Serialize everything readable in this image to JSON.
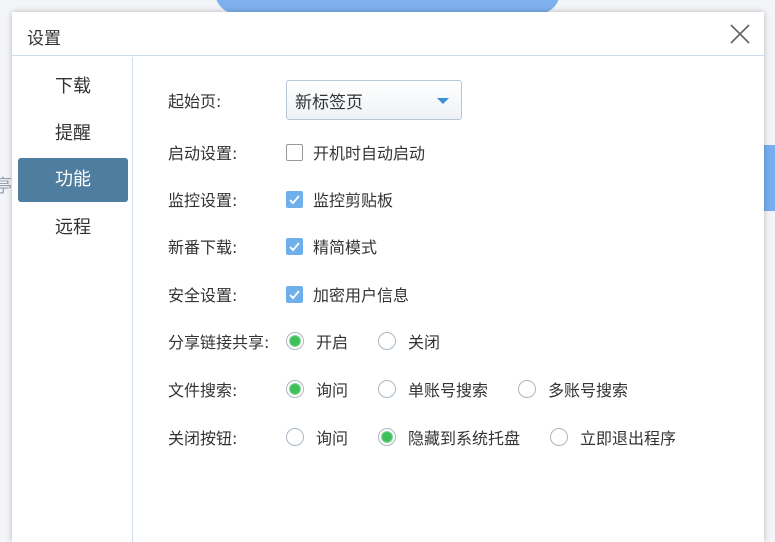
{
  "background": {
    "partial_text": "亭"
  },
  "dialog": {
    "title": "设置"
  },
  "sidebar": {
    "items": [
      {
        "label": "下载"
      },
      {
        "label": "提醒"
      },
      {
        "label": "功能",
        "active": true
      },
      {
        "label": "远程"
      }
    ]
  },
  "settings": {
    "start_page": {
      "label": "起始页:",
      "value": "新标签页"
    },
    "startup": {
      "label": "启动设置:",
      "option": "开机时自动启动",
      "checked": false
    },
    "monitor": {
      "label": "监控设置:",
      "option": "监控剪贴板",
      "checked": true
    },
    "new_download": {
      "label": "新番下载:",
      "option": "精简模式",
      "checked": true
    },
    "security": {
      "label": "安全设置:",
      "option": "加密用户信息",
      "checked": true
    },
    "share_link": {
      "label": "分享链接共享:",
      "options": [
        "开启",
        "关闭"
      ],
      "selected": 0
    },
    "file_search": {
      "label": "文件搜索:",
      "options": [
        "询问",
        "单账号搜索",
        "多账号搜索"
      ],
      "selected": 0
    },
    "close_button": {
      "label": "关闭按钮:",
      "options": [
        "询问",
        "隐藏到系统托盘",
        "立即退出程序"
      ],
      "selected": 1
    }
  },
  "colors": {
    "accent": "#4f7d9f",
    "checkbox": "#6fb0ec",
    "radio": "#3cc05a"
  }
}
